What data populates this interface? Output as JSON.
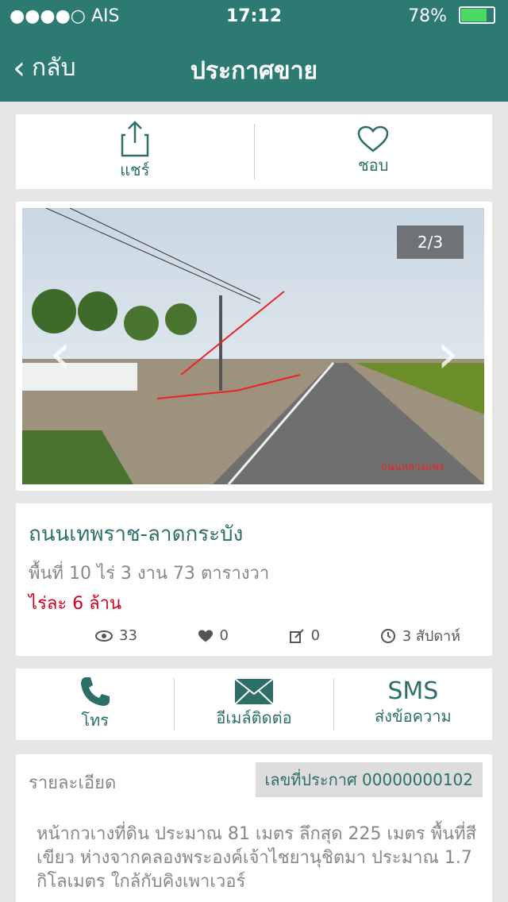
{
  "status": {
    "carrier": "●●●●○ AIS",
    "time": "17:12",
    "battery": "78%"
  },
  "nav": {
    "back_label": "กลับ",
    "title": "ประกาศขาย"
  },
  "actions": {
    "share": "แชร์",
    "like": "ชอบ"
  },
  "gallery": {
    "counter": "2/3",
    "road_label": "ถนนหลวงแพ่ง"
  },
  "listing": {
    "title": "ถนนเทพราช-ลาดกระบัง",
    "area": "พื้นที่ 10 ไร่ 3 งาน 73 ตารางวา",
    "price": "ไร่ละ 6 ล้าน"
  },
  "stats": {
    "views": "33",
    "likes": "0",
    "edits": "0",
    "age": "3 สัปดาห์"
  },
  "contact": {
    "call": "โทร",
    "email": "อีเมล์ติดต่อ",
    "sms_title": "SMS",
    "sms_label": "ส่งข้อความ"
  },
  "details": {
    "label": "รายละเอียด",
    "listing_number": "เลขที่ประกาศ 00000000102",
    "description": "หน้ากวเางที่ดิน ประมาณ 81 เมตร ลึกสุด 225 เมตร พื้นที่สีเขียว ห่างจากคลองพระองค์เจ้าไชยานุชิตมา ประมาณ 1.7 กิโลเมตร ใกล้กับคิงเพาเวอร์"
  },
  "colors": {
    "brand": "#2d7a72",
    "accent": "#2d6f68",
    "price": "#d0021b"
  }
}
